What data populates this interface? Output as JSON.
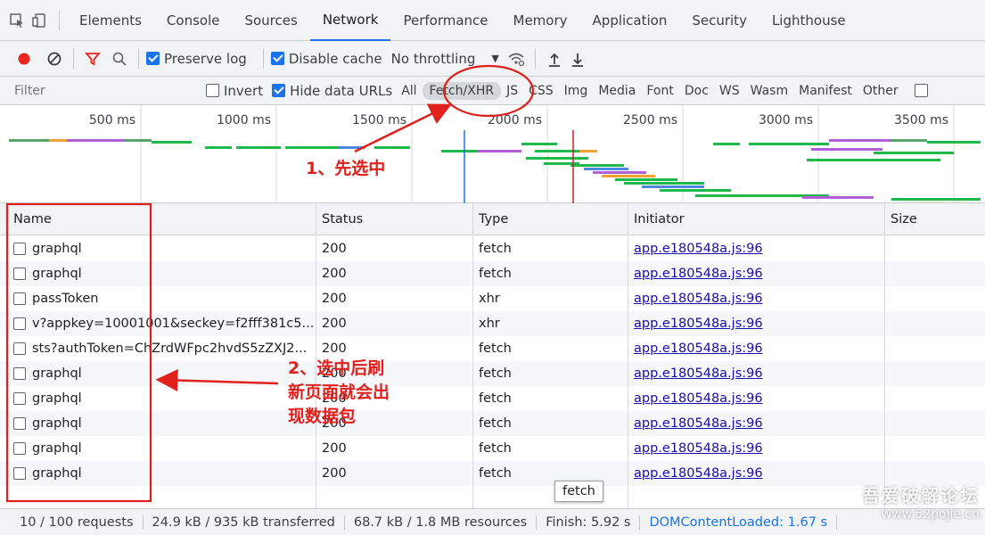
{
  "tabs": [
    "Elements",
    "Console",
    "Sources",
    "Network",
    "Performance",
    "Memory",
    "Application",
    "Security",
    "Lighthouse"
  ],
  "active_tab": "Network",
  "toolbar": {
    "preserve_log": "Preserve log",
    "disable_cache": "Disable cache",
    "throttling": "No throttling"
  },
  "filter": {
    "placeholder": "Filter",
    "invert": "Invert",
    "hide_data_urls": "Hide data URLs",
    "types": [
      "All",
      "Fetch/XHR",
      "JS",
      "CSS",
      "Img",
      "Media",
      "Font",
      "Doc",
      "WS",
      "Wasm",
      "Manifest",
      "Other"
    ],
    "active_type": "Fetch/XHR"
  },
  "overview": {
    "ticks": [
      "500 ms",
      "1000 ms",
      "1500 ms",
      "2000 ms",
      "2500 ms",
      "3000 ms",
      "3500 ms"
    ]
  },
  "grid": {
    "columns": [
      "Name",
      "Status",
      "Type",
      "Initiator",
      "Size"
    ],
    "rows": [
      {
        "name": "graphql",
        "status": "200",
        "type": "fetch",
        "initiator": "app.e180548a.js:96"
      },
      {
        "name": "graphql",
        "status": "200",
        "type": "fetch",
        "initiator": "app.e180548a.js:96"
      },
      {
        "name": "passToken",
        "status": "200",
        "type": "xhr",
        "initiator": "app.e180548a.js:96"
      },
      {
        "name": "v?appkey=10001001&seckey=f2fff381c5...",
        "status": "200",
        "type": "xhr",
        "initiator": "app.e180548a.js:96"
      },
      {
        "name": "sts?authToken=ChZrdWFpc2hvdS5zZXJ2...",
        "status": "200",
        "type": "fetch",
        "initiator": "app.e180548a.js:96"
      },
      {
        "name": "graphql",
        "status": "200",
        "type": "fetch",
        "initiator": "app.e180548a.js:96"
      },
      {
        "name": "graphql",
        "status": "200",
        "type": "fetch",
        "initiator": "app.e180548a.js:96"
      },
      {
        "name": "graphql",
        "status": "200",
        "type": "fetch",
        "initiator": "app.e180548a.js:96"
      },
      {
        "name": "graphql",
        "status": "200",
        "type": "fetch",
        "initiator": "app.e180548a.js:96"
      },
      {
        "name": "graphql",
        "status": "200",
        "type": "fetch",
        "initiator": "app.e180548a.js:96"
      }
    ]
  },
  "tooltip": "fetch",
  "statusbar": {
    "requests": "10 / 100 requests",
    "transferred": "24.9 kB / 935 kB transferred",
    "resources": "68.7 kB / 1.8 MB resources",
    "finish": "Finish: 5.92 s",
    "dcl": "DOMContentLoaded: 1.67 s"
  },
  "annotations": {
    "step1": "1、先选中",
    "step2": [
      "2、选中后刷",
      "新页面就会出",
      "现数据包"
    ]
  },
  "watermark": [
    "吾爱破解论坛",
    "www.52pojie.cn"
  ],
  "colors": {
    "accent": "#1a73e8",
    "record": "#e8251e",
    "annotation": "#e0201c",
    "link": "#1a0dab"
  }
}
